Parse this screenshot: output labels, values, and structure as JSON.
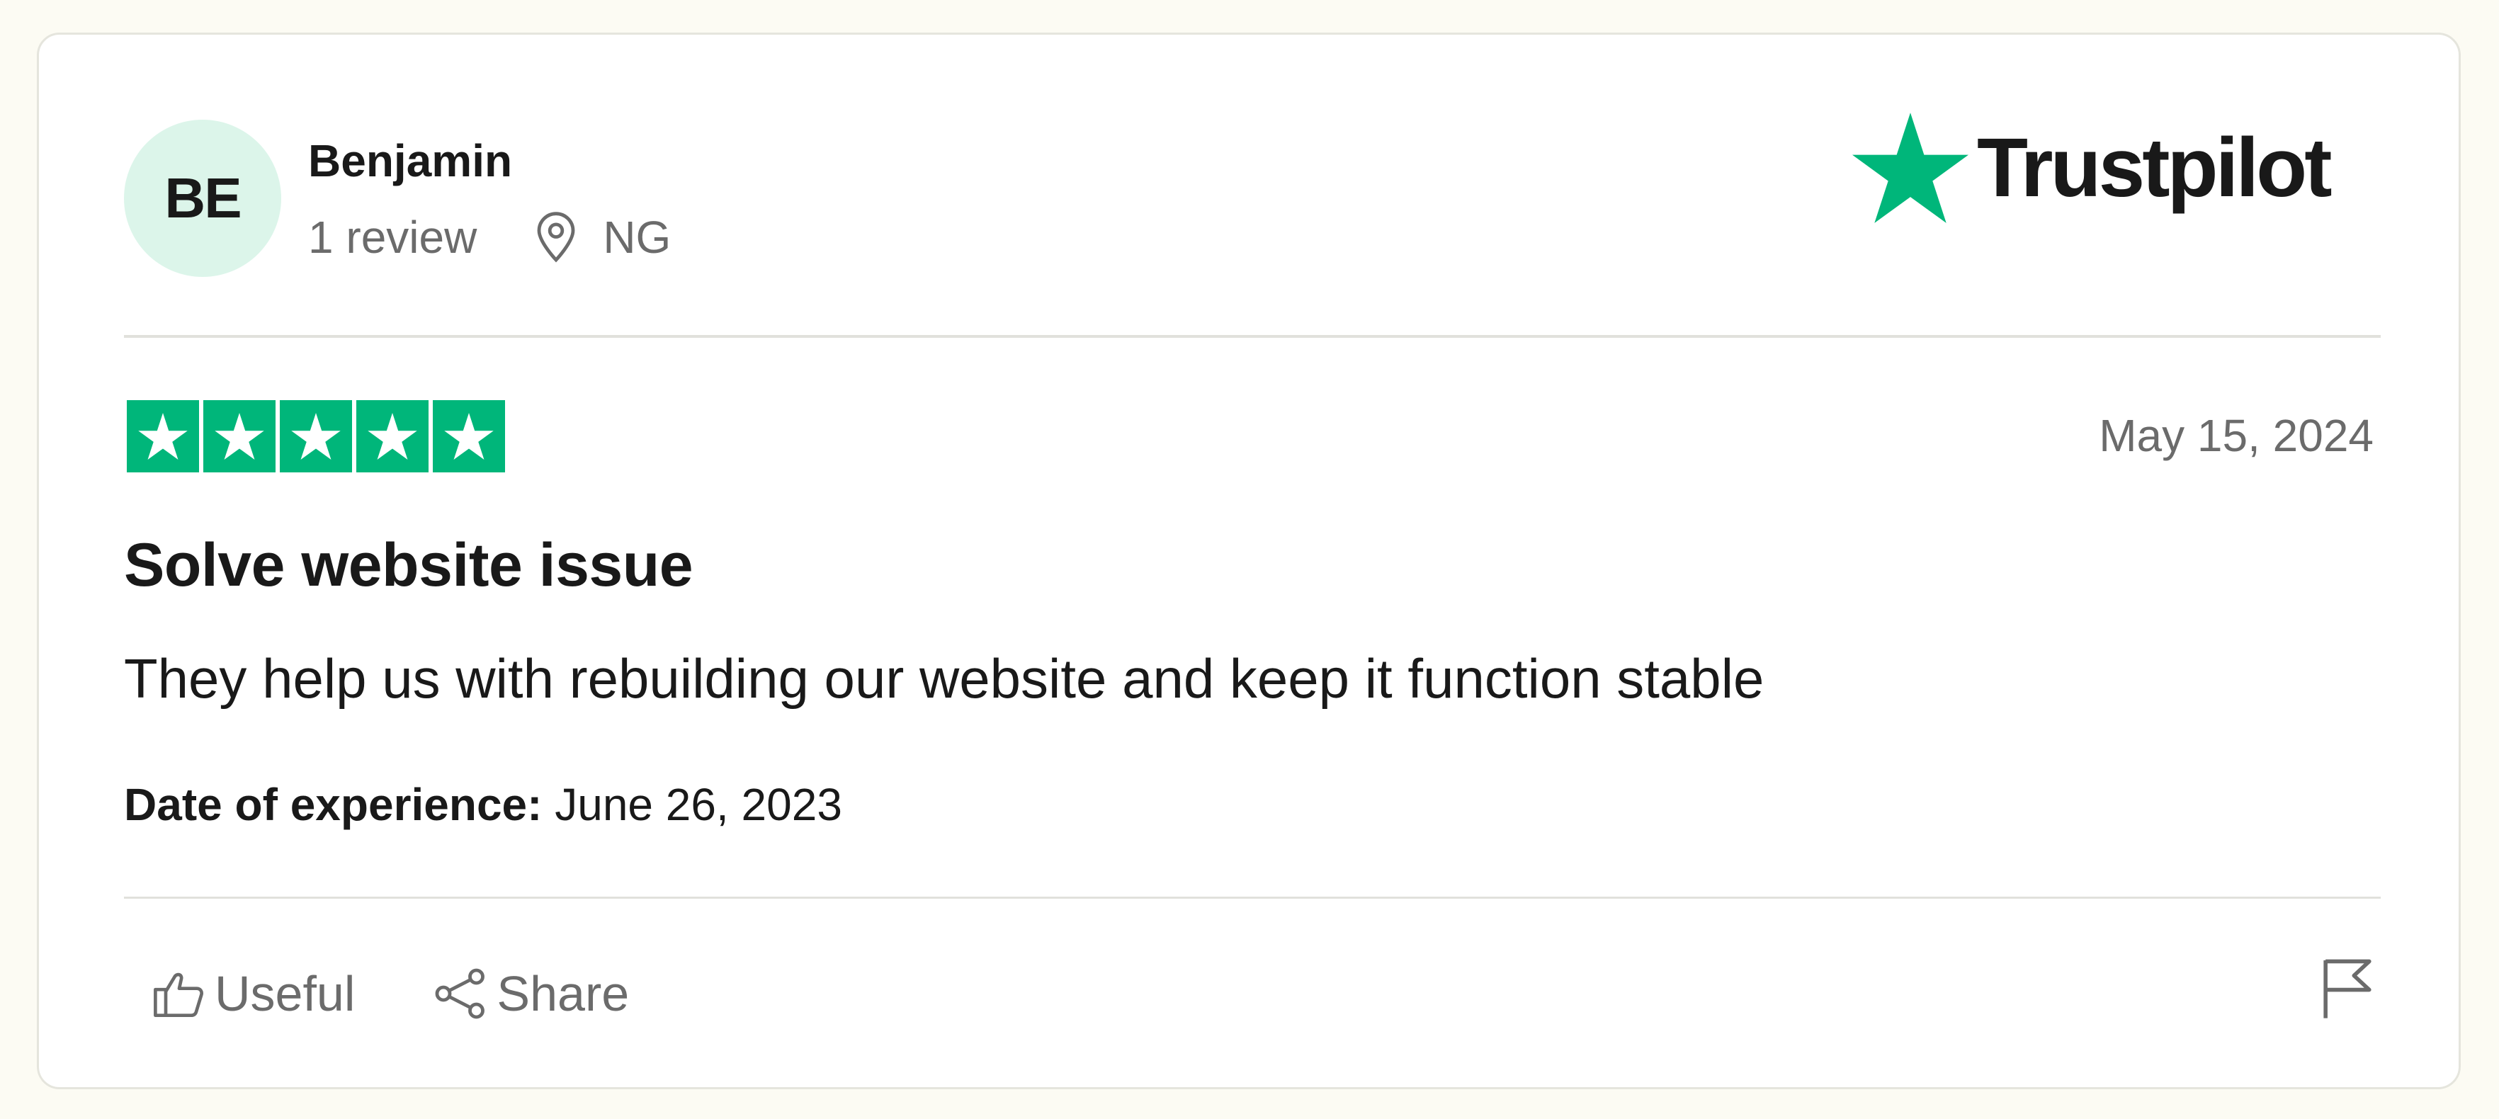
{
  "reviewer": {
    "initials": "BE",
    "name": "Benjamin",
    "review_count": "1 review",
    "location": "NG"
  },
  "brand": {
    "logo_text": "Trustpilot",
    "accent_color": "#00b67a"
  },
  "review": {
    "rating": 5,
    "rating_max": 5,
    "date": "May 15, 2024",
    "title": "Solve website issue",
    "body": "They help us with rebuilding our website and keep it function stable",
    "experience_label": "Date of experience:",
    "experience_date": "June 26, 2023"
  },
  "actions": {
    "useful_label": "Useful",
    "share_label": "Share",
    "useful_icon": "thumbs-up-icon",
    "share_icon": "share-icon",
    "report_icon": "flag-icon"
  }
}
